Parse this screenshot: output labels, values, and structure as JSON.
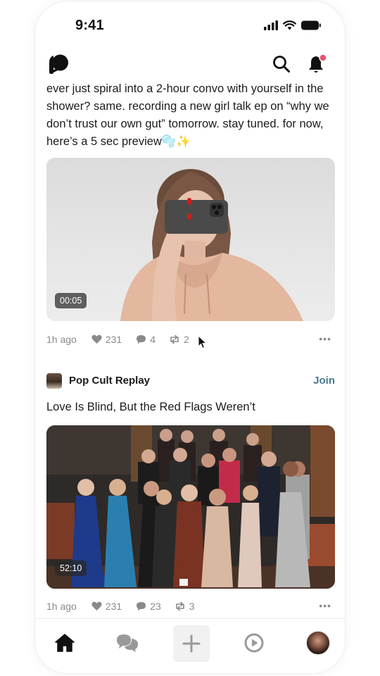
{
  "status_bar": {
    "time": "9:41"
  },
  "header": {
    "logo_icon": "patreon-logo-icon",
    "search_icon": "search-icon",
    "bell_icon": "bell-icon",
    "notification_dot_color": "#f0506e"
  },
  "post1": {
    "text": "ever just spiral into a 2-hour convo with yourself in the shower? same. recording a new girl talk ep on “why we don’t trust our own gut” tomorrow. stay tuned. for now, here’s a 5 sec preview🫧✨",
    "media_duration": "00:05",
    "time_ago": "1h ago",
    "likes": "231",
    "comments": "4",
    "reposts": "2"
  },
  "post2": {
    "community_name": "Pop Cult Replay",
    "join_label": "Join",
    "title": "Love Is Blind, But the Red Flags Weren’t",
    "media_duration": "52:10",
    "time_ago": "1h ago",
    "likes": "231",
    "comments": "23",
    "reposts": "3"
  },
  "tab_bar": {
    "items": [
      "home-icon",
      "chat-icon",
      "add-icon",
      "play-icon",
      "profile-avatar"
    ]
  },
  "colors": {
    "accent_link": "#4a7a92",
    "meta_text": "#8a8a8a"
  }
}
